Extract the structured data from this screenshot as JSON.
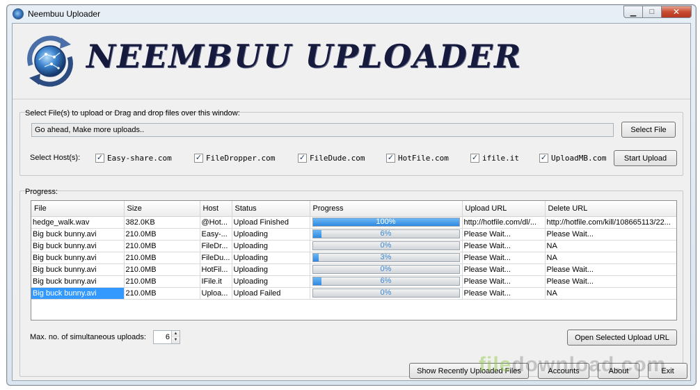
{
  "window": {
    "title": "Neembuu Uploader",
    "controls": {
      "minimize": "▁",
      "maximize": "□",
      "close": "✕"
    }
  },
  "banner": {
    "logo_text": "NEEMBUU UPLOADER"
  },
  "select_section": {
    "label": "Select File(s) to upload or Drag and drop files over this window:",
    "input_value": "Go ahead, Make more uploads..",
    "select_button": "Select File",
    "hosts_label": "Select Host(s):",
    "hosts": [
      {
        "name": "Easy-share.com",
        "checked": true
      },
      {
        "name": "FileDropper.com",
        "checked": true
      },
      {
        "name": "FileDude.com",
        "checked": true
      },
      {
        "name": "HotFile.com",
        "checked": true
      },
      {
        "name": "ifile.it",
        "checked": true
      },
      {
        "name": "UploadMB.com",
        "checked": true
      }
    ],
    "start_button": "Start Upload"
  },
  "progress_section": {
    "label": "Progress:",
    "columns": [
      "File",
      "Size",
      "Host",
      "Status",
      "Progress",
      "Upload URL",
      "Delete URL"
    ],
    "rows": [
      {
        "file": "hedge_walk.wav",
        "size": "382.0KB",
        "host": "@Hot...",
        "status": "Upload Finished",
        "progress": 100,
        "progress_text": "100%",
        "upload_url": "http://hotfile.com/dl/...",
        "delete_url": "http://hotfile.com/kill/108665113/22...",
        "selected": false
      },
      {
        "file": "Big buck bunny.avi",
        "size": "210.0MB",
        "host": "Easy-...",
        "status": "Uploading",
        "progress": 6,
        "progress_text": "6%",
        "upload_url": "Please Wait...",
        "delete_url": "Please Wait...",
        "selected": false
      },
      {
        "file": "Big buck bunny.avi",
        "size": "210.0MB",
        "host": "FileDr...",
        "status": "Uploading",
        "progress": 0,
        "progress_text": "0%",
        "upload_url": "Please Wait...",
        "delete_url": "NA",
        "selected": false
      },
      {
        "file": "Big buck bunny.avi",
        "size": "210.0MB",
        "host": "FileDu...",
        "status": "Uploading",
        "progress": 3,
        "progress_text": "3%",
        "upload_url": "Please Wait...",
        "delete_url": "NA",
        "selected": false
      },
      {
        "file": "Big buck bunny.avi",
        "size": "210.0MB",
        "host": "HotFil...",
        "status": "Uploading",
        "progress": 0,
        "progress_text": "0%",
        "upload_url": "Please Wait...",
        "delete_url": "Please Wait...",
        "selected": false
      },
      {
        "file": "Big buck bunny.avi",
        "size": "210.0MB",
        "host": "IFile.it",
        "status": "Uploading",
        "progress": 6,
        "progress_text": "6%",
        "upload_url": "Please Wait...",
        "delete_url": "Please Wait...",
        "selected": false
      },
      {
        "file": "Big buck bunny.avi",
        "size": "210.0MB",
        "host": "Uploa...",
        "status": "Upload Failed",
        "progress": 0,
        "progress_text": "0%",
        "upload_url": "Please Wait...",
        "delete_url": "NA",
        "selected": true
      }
    ]
  },
  "bottom": {
    "max_label": "Max. no. of simultaneous uploads:",
    "max_value": "6",
    "open_url_button": "Open Selected Upload URL",
    "recent_button": "Show Recently Uploaded Files",
    "accounts_button": "Accounts",
    "about_button": "About",
    "exit_button": "Exit"
  },
  "watermark": {
    "part1": "file",
    "part2": "download.com"
  },
  "colors": {
    "accent": "#3399ff",
    "progress_fill": "#2e8ae0",
    "logo_text": "#161a3c"
  }
}
